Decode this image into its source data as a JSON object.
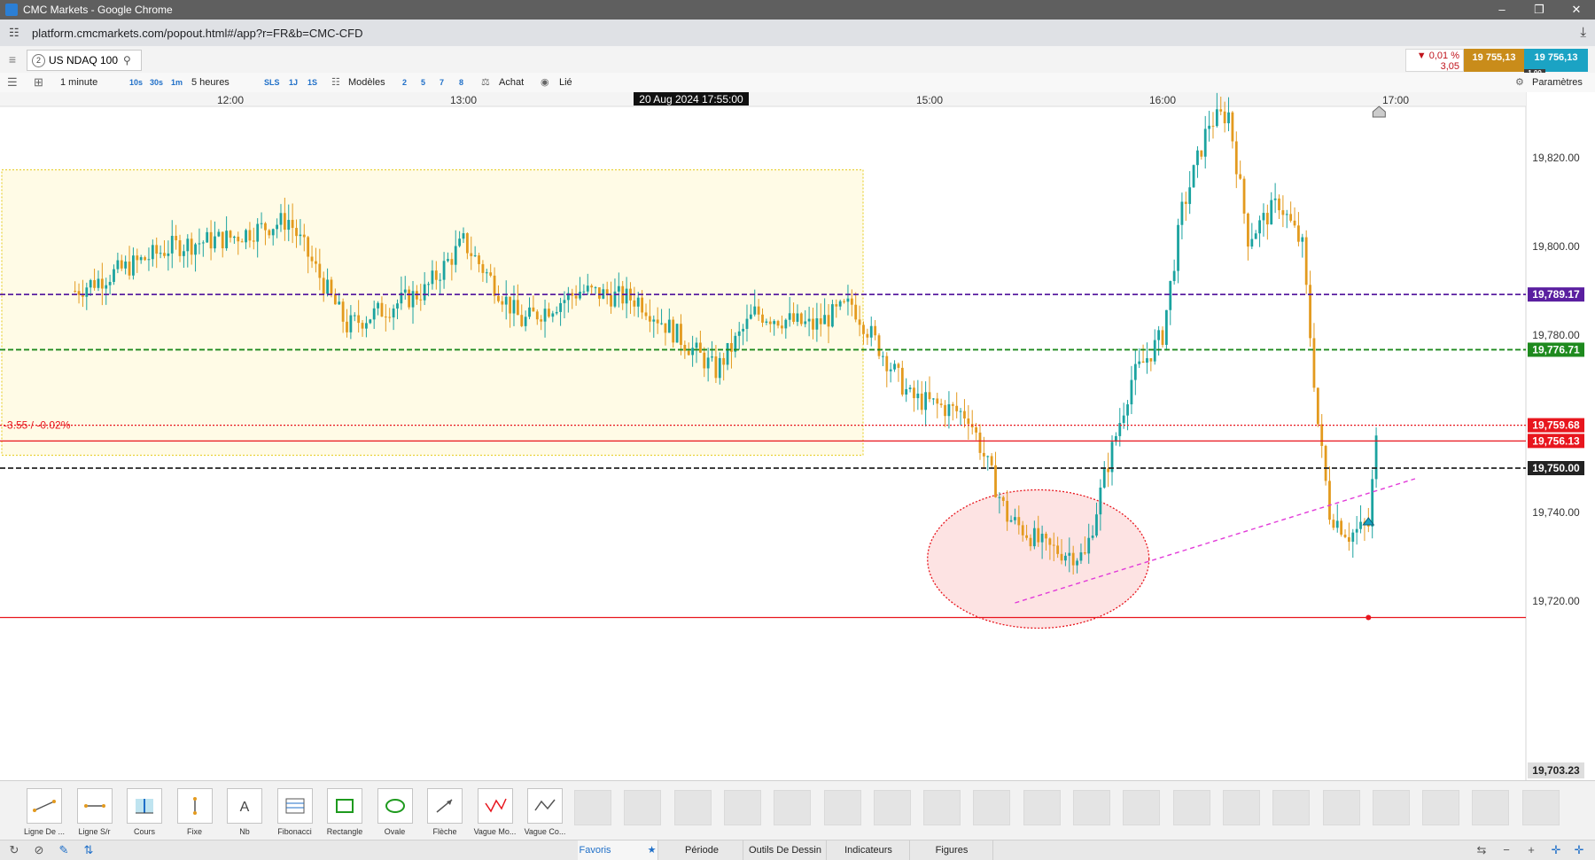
{
  "window": {
    "title": "CMC Markets - Google Chrome",
    "controls": [
      "–",
      "❐",
      "✕"
    ]
  },
  "browser": {
    "url": "platform.cmcmarkets.com/popout.html#/app?r=FR&b=CMC-CFD"
  },
  "instrument": {
    "badge": "2",
    "name": "US NDAQ 100",
    "change_pct": "▼ 0,01 %",
    "change_abs": "3,05",
    "sell": "19 755,13",
    "buy": "19 756,13",
    "spread": "1,00"
  },
  "toolbar": {
    "interval": "1 minute",
    "q10s": "10s",
    "q30s": "30s",
    "q1m": "1m",
    "range": "5 heures",
    "sls": "SLS",
    "r1j": "1J",
    "r1s": "1S",
    "templates": "Modèles",
    "n2": "2",
    "n5": "5",
    "n7": "7",
    "n8": "8",
    "buy_mode": "Achat",
    "linked": "Lié",
    "settings": "Paramètres"
  },
  "chart_data": {
    "type": "candlestick",
    "instrument": "US NDAQ 100",
    "interval": "1 minute",
    "x_ticks": [
      "12:00",
      "13:00",
      "15:00",
      "16:00",
      "17:00"
    ],
    "crosshair_time": "20 Aug 2024 17:55:00",
    "y_ticks": [
      "19,820.00",
      "19,800.00",
      "19,780.00",
      "19,740.00",
      "19,720.00"
    ],
    "ylim": [
      19703.23,
      19836
    ],
    "bottom_label": "19,703.23",
    "horizontal_lines": [
      {
        "value": 19789.17,
        "label": "19,789.17",
        "color": "#5a1fa0",
        "style": "dashed"
      },
      {
        "value": 19776.71,
        "label": "19,776.71",
        "color": "#1e8a1e",
        "style": "dashed"
      },
      {
        "value": 19759.68,
        "label": "19,759.68",
        "color": "#e8161e",
        "style": "dotted"
      },
      {
        "value": 19756.13,
        "label": "19,756.13",
        "color": "#e8161e",
        "style": "solid"
      },
      {
        "value": 19750.0,
        "label": "19,750.00",
        "color": "#222222",
        "style": "dashed"
      },
      {
        "value": 19716.3,
        "label": "",
        "color": "#e8161e",
        "style": "solid"
      }
    ],
    "change_label": "-3.55 / -0.02%",
    "anchors": [
      [
        "11:20",
        19790
      ],
      [
        "11:45",
        19800
      ],
      [
        "12:00",
        19802
      ],
      [
        "12:15",
        19806
      ],
      [
        "12:30",
        19782
      ],
      [
        "12:50",
        19790
      ],
      [
        "13:00",
        19801
      ],
      [
        "13:15",
        19783
      ],
      [
        "13:30",
        19790
      ],
      [
        "13:45",
        19788
      ],
      [
        "14:05",
        19772
      ],
      [
        "14:15",
        19785
      ],
      [
        "14:30",
        19782
      ],
      [
        "14:40",
        19787
      ],
      [
        "14:55",
        19766
      ],
      [
        "15:10",
        19762
      ],
      [
        "15:20",
        19739
      ],
      [
        "15:30",
        19732
      ],
      [
        "15:40",
        19730
      ],
      [
        "15:45",
        19748
      ],
      [
        "15:52",
        19770
      ],
      [
        "16:00",
        19780
      ],
      [
        "16:05",
        19808
      ],
      [
        "16:12",
        19828
      ],
      [
        "16:17",
        19830
      ],
      [
        "16:22",
        19802
      ],
      [
        "16:30",
        19810
      ],
      [
        "16:36",
        19800
      ],
      [
        "16:40",
        19760
      ],
      [
        "16:43",
        19740
      ],
      [
        "16:48",
        19735
      ],
      [
        "16:53",
        19737
      ],
      [
        "16:55",
        19756
      ]
    ]
  },
  "drawing_tools": [
    {
      "label": "Ligne De ...",
      "icon": "line-icon"
    },
    {
      "label": "Ligne S/r",
      "icon": "sr-line-icon"
    },
    {
      "label": "Cours",
      "icon": "price-icon"
    },
    {
      "label": "Fixe",
      "icon": "fixed-icon"
    },
    {
      "label": "Nb",
      "icon": "text-icon"
    },
    {
      "label": "Fibonacci",
      "icon": "fibonacci-icon"
    },
    {
      "label": "Rectangle",
      "icon": "rectangle-icon"
    },
    {
      "label": "Ovale",
      "icon": "oval-icon"
    },
    {
      "label": "Flèche",
      "icon": "arrow-icon"
    },
    {
      "label": "Vague Mo...",
      "icon": "wave-icon"
    },
    {
      "label": "Vague Co...",
      "icon": "corrective-wave-icon"
    }
  ],
  "bottom_tabs": {
    "favoris": "Favoris",
    "periode": "Période",
    "outils": "Outils De Dessin",
    "indicateurs": "Indicateurs",
    "figures": "Figures"
  }
}
